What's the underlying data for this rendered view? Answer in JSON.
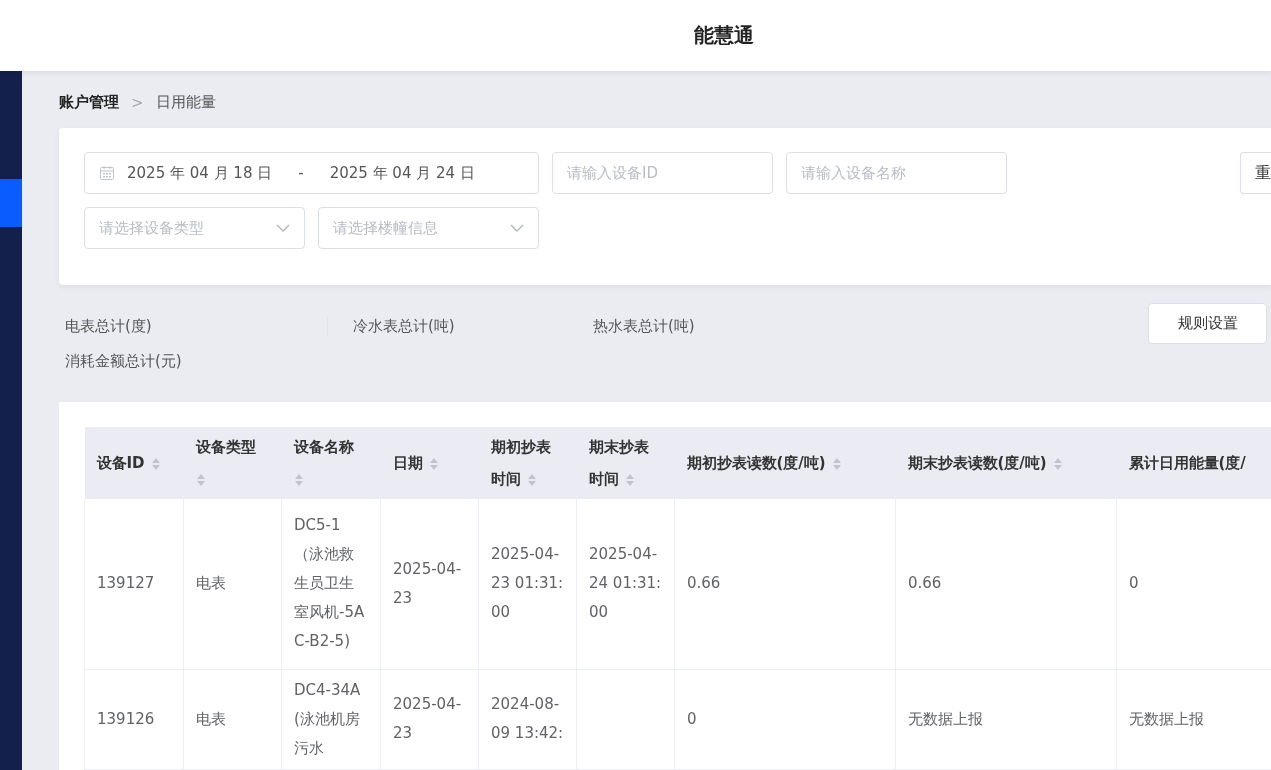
{
  "header": {
    "title": "能慧通"
  },
  "sidebar": {
    "items": [
      {
        "selected": true
      }
    ]
  },
  "breadcrumb": [
    {
      "label": "账户管理",
      "current": false
    },
    {
      "label": "日用能量",
      "current": true
    }
  ],
  "breadcrumb_separator": ">",
  "filters": {
    "date_range": {
      "start": "2025 年 04 月 18 日",
      "separator": "-",
      "end": "2025 年 04 月 24 日"
    },
    "device_id": {
      "placeholder": "请输入设备ID"
    },
    "device_name": {
      "placeholder": "请输入设备名称"
    },
    "device_type": {
      "placeholder": "请选择设备类型"
    },
    "building": {
      "placeholder": "请选择楼幢信息"
    },
    "reset_button": "重"
  },
  "totals": [
    {
      "label": "电表总计(度)"
    },
    {
      "label": "冷水表总计(吨)"
    },
    {
      "label": "热水表总计(吨)"
    },
    {
      "label": "消耗金额总计(元)"
    }
  ],
  "rule_button": "规则设置",
  "table": {
    "columns": [
      {
        "label": "设备ID",
        "sortable": true
      },
      {
        "label": "设备类型",
        "sortable": true
      },
      {
        "label": "设备名称",
        "sortable": true
      },
      {
        "label": "日期",
        "sortable": true
      },
      {
        "label": "期初抄表时间",
        "sortable": true
      },
      {
        "label": "期末抄表时间",
        "sortable": true
      },
      {
        "label": "期初抄表读数(度/吨)",
        "sortable": true
      },
      {
        "label": "期末抄表读数(度/吨)",
        "sortable": true
      },
      {
        "label": "累计日用能量(度/",
        "sortable": false
      }
    ],
    "rows": [
      [
        "139127",
        "电表",
        "DC5-1 （泳池救生员卫生室风机-5AC-B2-5)",
        "2025-04-23",
        "2025-04-23 01:31:00",
        "2025-04-24 01:31:00",
        "0.66",
        "0.66",
        "0"
      ],
      [
        "139126",
        "电表",
        "DC4-34A(泳池机房污水",
        "2025-04-23",
        "2024-08-09 13:42:",
        "",
        "0",
        "无数据上报",
        "无数据上报"
      ]
    ]
  }
}
